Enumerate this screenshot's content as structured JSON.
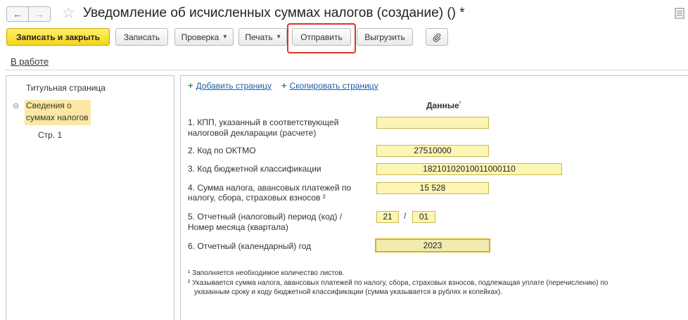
{
  "window": {
    "title": "Уведомление об исчисленных суммах налогов (создание) () *",
    "nav_back_icon": "←",
    "nav_forward_icon": "→",
    "star_icon": "☆"
  },
  "toolbar": {
    "save_close": "Записать и закрыть",
    "save": "Записать",
    "check": "Проверка",
    "print": "Печать",
    "send": "Отправить",
    "export": "Выгрузить",
    "attach_icon": "paperclip-icon"
  },
  "status": {
    "link": "В работе"
  },
  "tree": {
    "items": [
      {
        "label": "Титульная страница"
      },
      {
        "label_line1": "Сведения о",
        "label_line2": "суммах налогов",
        "toggle": "⊖"
      },
      {
        "label": "Стр. 1"
      }
    ]
  },
  "actions": {
    "add_page": "Добавить страницу",
    "copy_page": "Скопировать страницу",
    "plus": "+"
  },
  "form": {
    "column_header": "Данные",
    "column_header_sup": "¹",
    "rows": [
      {
        "label_line1": "1. КПП, указанный в соответствующей",
        "label_line2": "налоговой декларации (расчете)",
        "value": ""
      },
      {
        "label_line1": "2. Код по ОКТМО",
        "value": "27510000"
      },
      {
        "label_line1": "3. Код бюджетной классификации",
        "value": "18210102010011000110"
      },
      {
        "label_line1": "4. Сумма налога, авансовых платежей по",
        "label_line2": "налогу, сбора, страховых взносов ²",
        "value": "15 528"
      },
      {
        "label_line1": "5. Отчетный (налоговый) период (код) /",
        "label_line2": "Номер месяца (квартала)",
        "value": "21",
        "value2": "01"
      },
      {
        "label_line1": "6. Отчетный (календарный) год",
        "value": "2023"
      }
    ],
    "slash": "/"
  },
  "footnotes": {
    "note1": "¹ Заполняется необходимое количество листов.",
    "note2_line1": "² Указывается сумма налога, авансовых платежей по налогу, сбора, страховых взносов, подлежащая уплате (перечислению) по",
    "note2_line2": "указанным сроку и коду бюджетной классификации (сумма указывается в рублях и копейках)."
  },
  "colors": {
    "primary_button": "#f4d51c",
    "field_bg": "#fdf5b4",
    "selection": "#fbe8a4",
    "highlight_box": "#d9342b",
    "link": "#1a5fa8",
    "plus": "#2a9b2a"
  }
}
